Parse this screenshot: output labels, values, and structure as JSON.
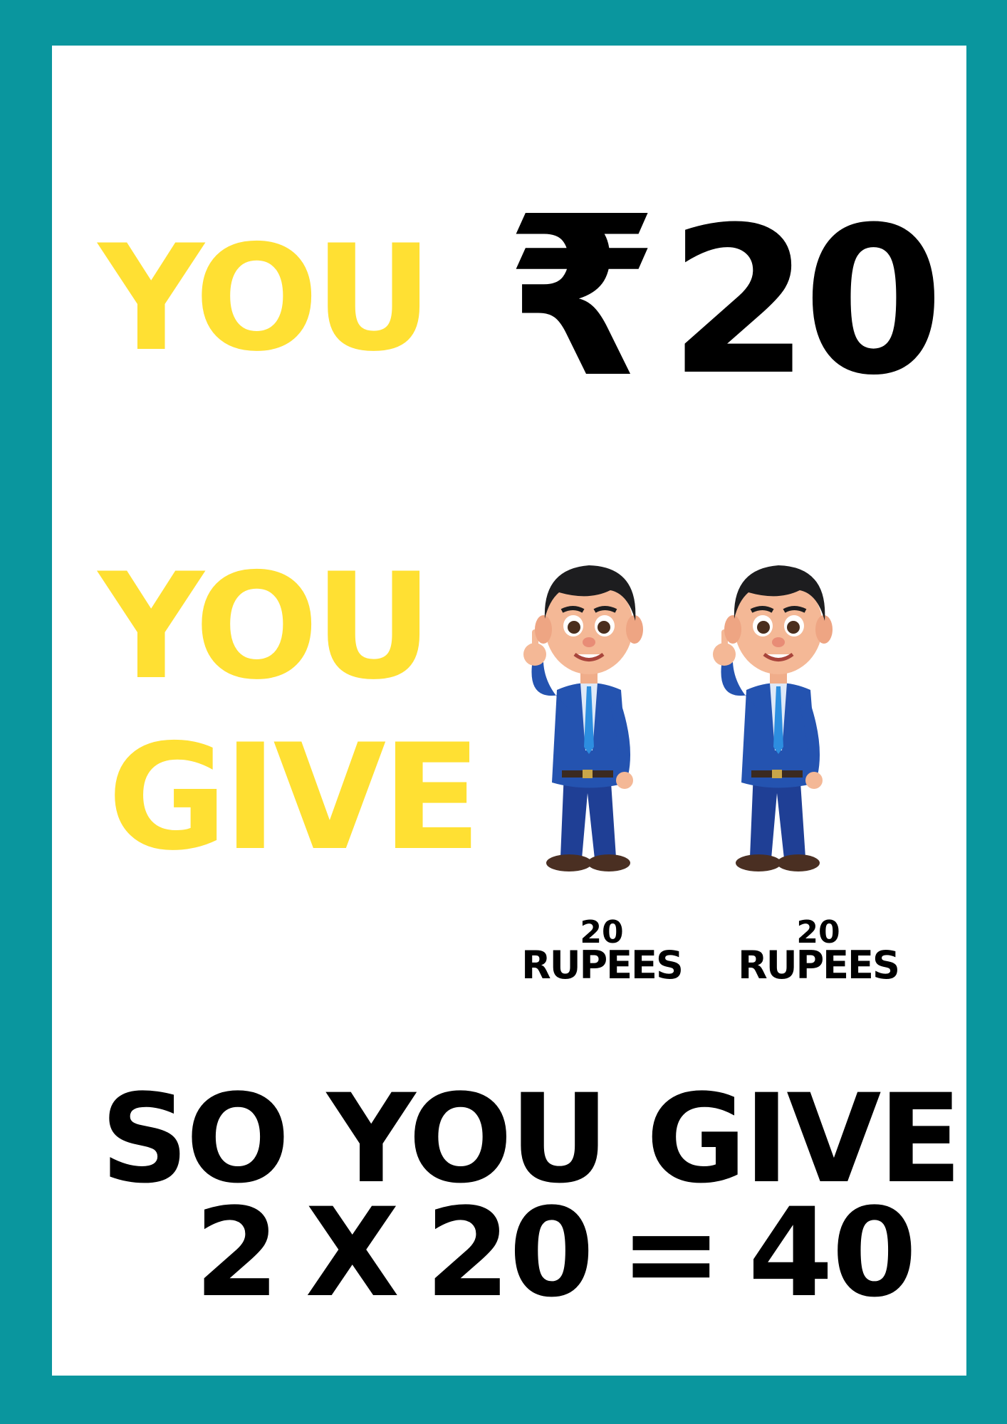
{
  "line1": {
    "you": "YOU",
    "currency_symbol": "₹",
    "amount": "20"
  },
  "line2": {
    "you": "YOU",
    "give": "GIVE"
  },
  "people": [
    {
      "icon": "businessman-thumbs-up-icon",
      "number": "20",
      "unit": "RUPEES"
    },
    {
      "icon": "businessman-thumbs-up-icon",
      "number": "20",
      "unit": "RUPEES"
    }
  ],
  "conclusion": {
    "line1": "SO YOU GIVE",
    "line2": "2 X 20 = 40"
  },
  "colors": {
    "border": "#0a969e",
    "highlight": "#ffe033",
    "text": "#000000"
  }
}
